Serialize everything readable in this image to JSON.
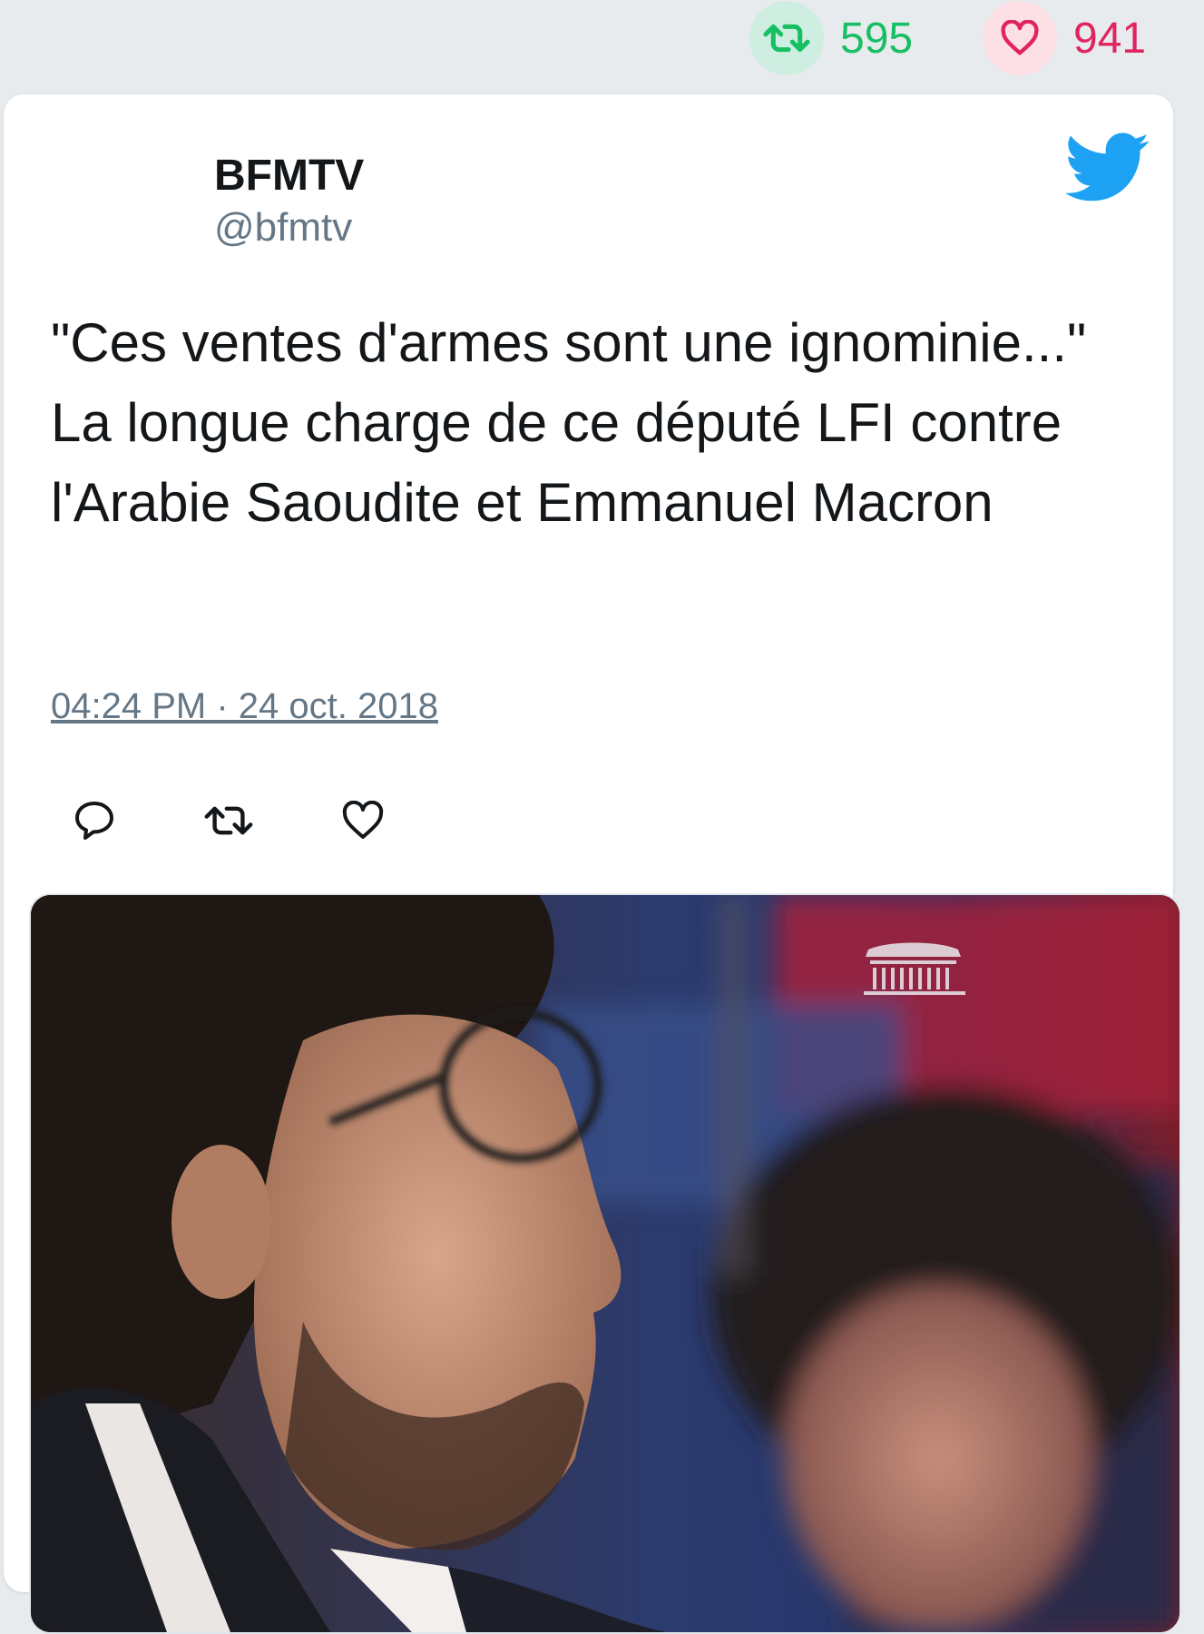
{
  "stats": {
    "retweets": "595",
    "likes": "941",
    "retweet_color": "#17bf63",
    "like_color": "#e0245e"
  },
  "tweet": {
    "display_name": "BFMTV",
    "handle": "@bfmtv",
    "text": "\"Ces ventes d'armes sont une ignominie...\" La longue charge de ce député LFI contre l'Arabie Saoudite et Emmanuel Macron",
    "timestamp": "04:24 PM · 24 oct. 2018"
  },
  "icons": {
    "brand": "twitter-bird-icon",
    "actions": [
      "reply-icon",
      "retweet-icon",
      "like-icon"
    ],
    "media_watermark": "parliament-building-icon"
  },
  "colors": {
    "twitter_blue": "#1da1f2",
    "text": "#14171a",
    "secondary": "#657786"
  }
}
